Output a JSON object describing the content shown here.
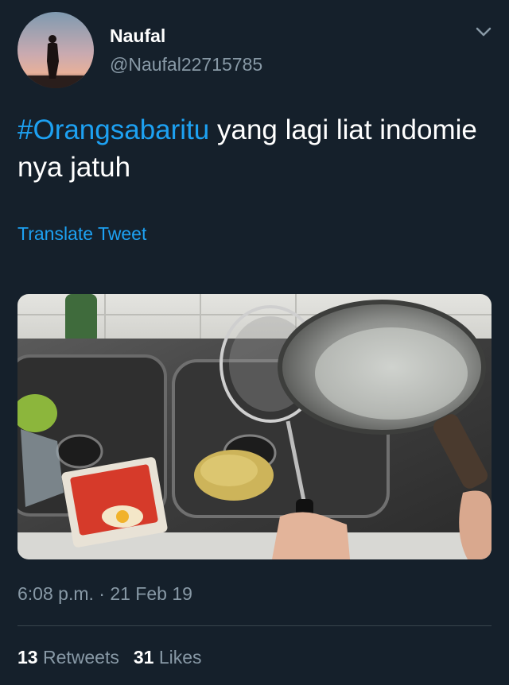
{
  "user": {
    "name": "Naufal",
    "handle": "@Naufal22715785"
  },
  "tweet": {
    "hashtag": "#Orangsabaritu",
    "text": " yang lagi liat indomie nya jatuh",
    "translate_label": "Translate Tweet",
    "timestamp": "6:08 p.m. · 21 Feb 19"
  },
  "stats": {
    "retweets_count": "13",
    "retweets_label": "Retweets",
    "likes_count": "31",
    "likes_label": "Likes"
  },
  "icons": {
    "menu": "chevron-down-icon"
  },
  "colors": {
    "background": "#15202b",
    "accent": "#1da1f2",
    "secondary_text": "#8899a6",
    "divider": "#38444d"
  }
}
